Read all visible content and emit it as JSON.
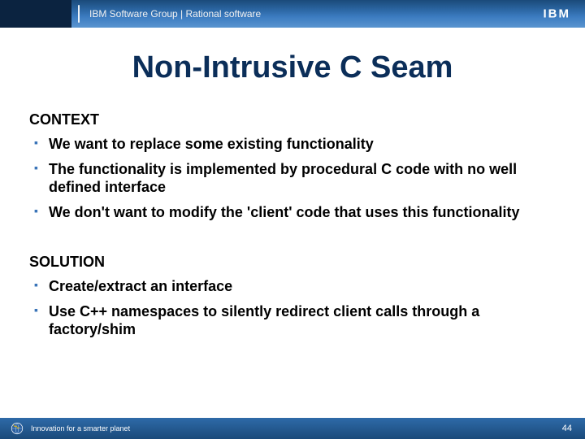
{
  "header": {
    "title": "IBM Software Group | Rational software",
    "logo_text": "IBM"
  },
  "title": "Non-Intrusive C Seam",
  "sections": [
    {
      "heading": "CONTEXT",
      "items": [
        "We want to replace some existing functionality",
        "The functionality is implemented by procedural C code with no well defined interface",
        "We don't want to modify the 'client' code that uses this functionality"
      ]
    },
    {
      "heading": "SOLUTION",
      "items": [
        "Create/extract an interface",
        "Use C++ namespaces to silently redirect client calls through a factory/shim"
      ]
    }
  ],
  "footer": {
    "tagline": "Innovation for a smarter planet",
    "page": "44"
  }
}
